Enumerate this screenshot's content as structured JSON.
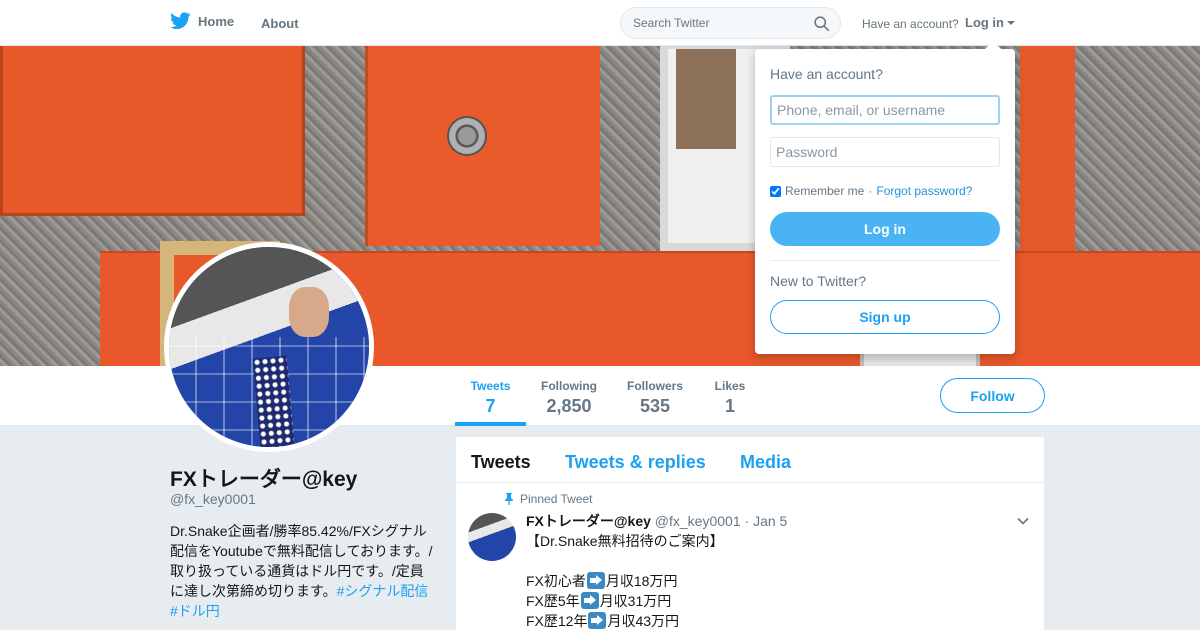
{
  "topbar": {
    "home_label": "Home",
    "about_label": "About",
    "search_placeholder": "Search Twitter",
    "have_account_text": "Have an account?",
    "login_label": "Log in",
    "brand_color": "#1da1f2"
  },
  "profile": {
    "name": "FXトレーダー@key",
    "handle": "@fx_key0001",
    "bio_text": "Dr.Snake企画者/勝率85.42%/FXシグナル配信をYoutubeで無料配信しております。/取り扱っている通貨はドル円です。/定員に達し次第締め切ります。",
    "bio_hashtag_1": "#シグナル配信",
    "bio_hashtag_2": "#ドル円"
  },
  "stats": [
    {
      "label": "Tweets",
      "value": "7"
    },
    {
      "label": "Following",
      "value": "2,850"
    },
    {
      "label": "Followers",
      "value": "535"
    },
    {
      "label": "Likes",
      "value": "1"
    }
  ],
  "follow_label": "Follow",
  "timeline": {
    "tabs": [
      "Tweets",
      "Tweets & replies",
      "Media"
    ],
    "pinned_label": "Pinned Tweet",
    "tweet": {
      "name": "FXトレーダー@key",
      "handle": "@fx_key0001",
      "date": "· Jan 5",
      "line1": "【Dr.Snake無料招待のご案内】",
      "line2a": "FX初心者",
      "line2b": "月収18万円",
      "line3a": "FX歴5年",
      "line3b": "月収31万円",
      "line4a": "FX歴12年",
      "line4b": "月収43万円"
    }
  },
  "login_dropdown": {
    "title": "Have an account?",
    "username_placeholder": "Phone, email, or username",
    "password_placeholder": "Password",
    "remember_label": "Remember me",
    "separator": "·",
    "forgot_label": "Forgot password?",
    "login_button": "Log in",
    "new_label": "New to Twitter?",
    "signup_button": "Sign up"
  }
}
